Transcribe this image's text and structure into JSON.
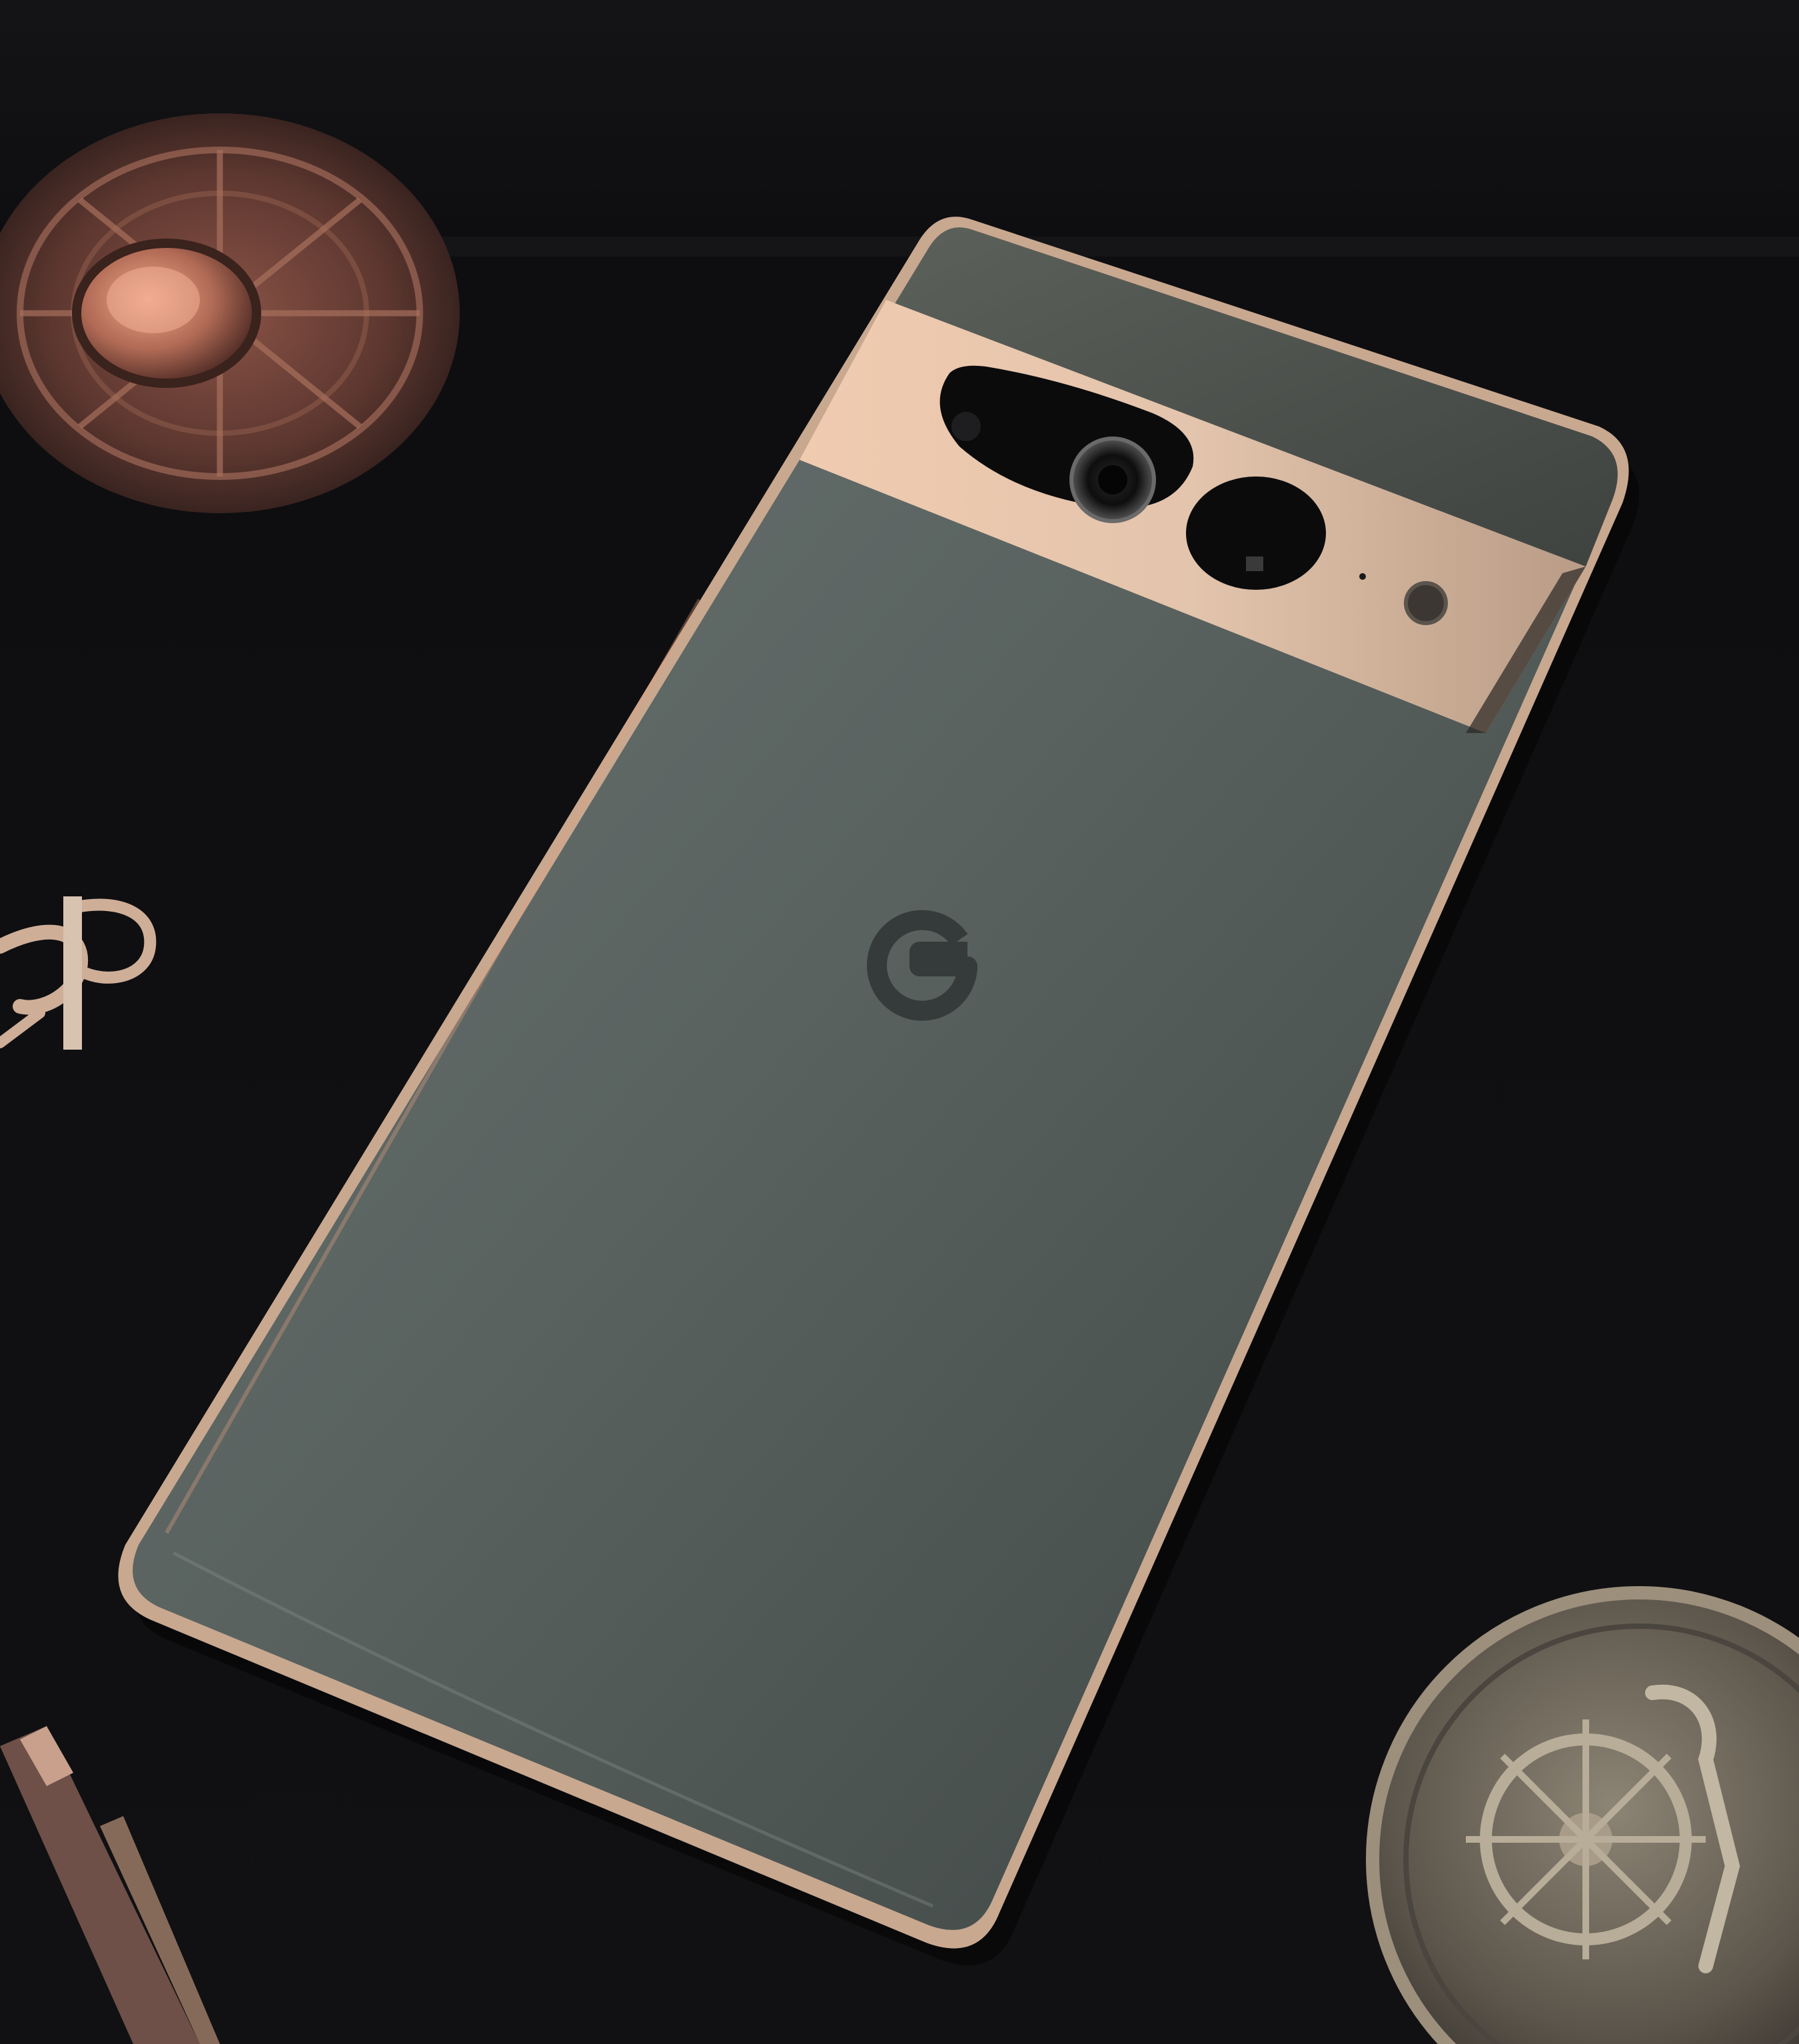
{
  "scene": {
    "background_color": "#101012",
    "objects": [
      {
        "name": "smartphone",
        "facing": "back",
        "body_color": "#56605f",
        "camera_bar_color": "#e2c2a8",
        "logo": "G"
      },
      {
        "name": "ornate-medallion",
        "color": "#7a4a3f"
      },
      {
        "name": "anchor-pendant",
        "color": "#d6b7a0"
      },
      {
        "name": "pen",
        "color": "#7a5a52"
      },
      {
        "name": "pirate-coin",
        "color": "#6a6258"
      }
    ]
  }
}
